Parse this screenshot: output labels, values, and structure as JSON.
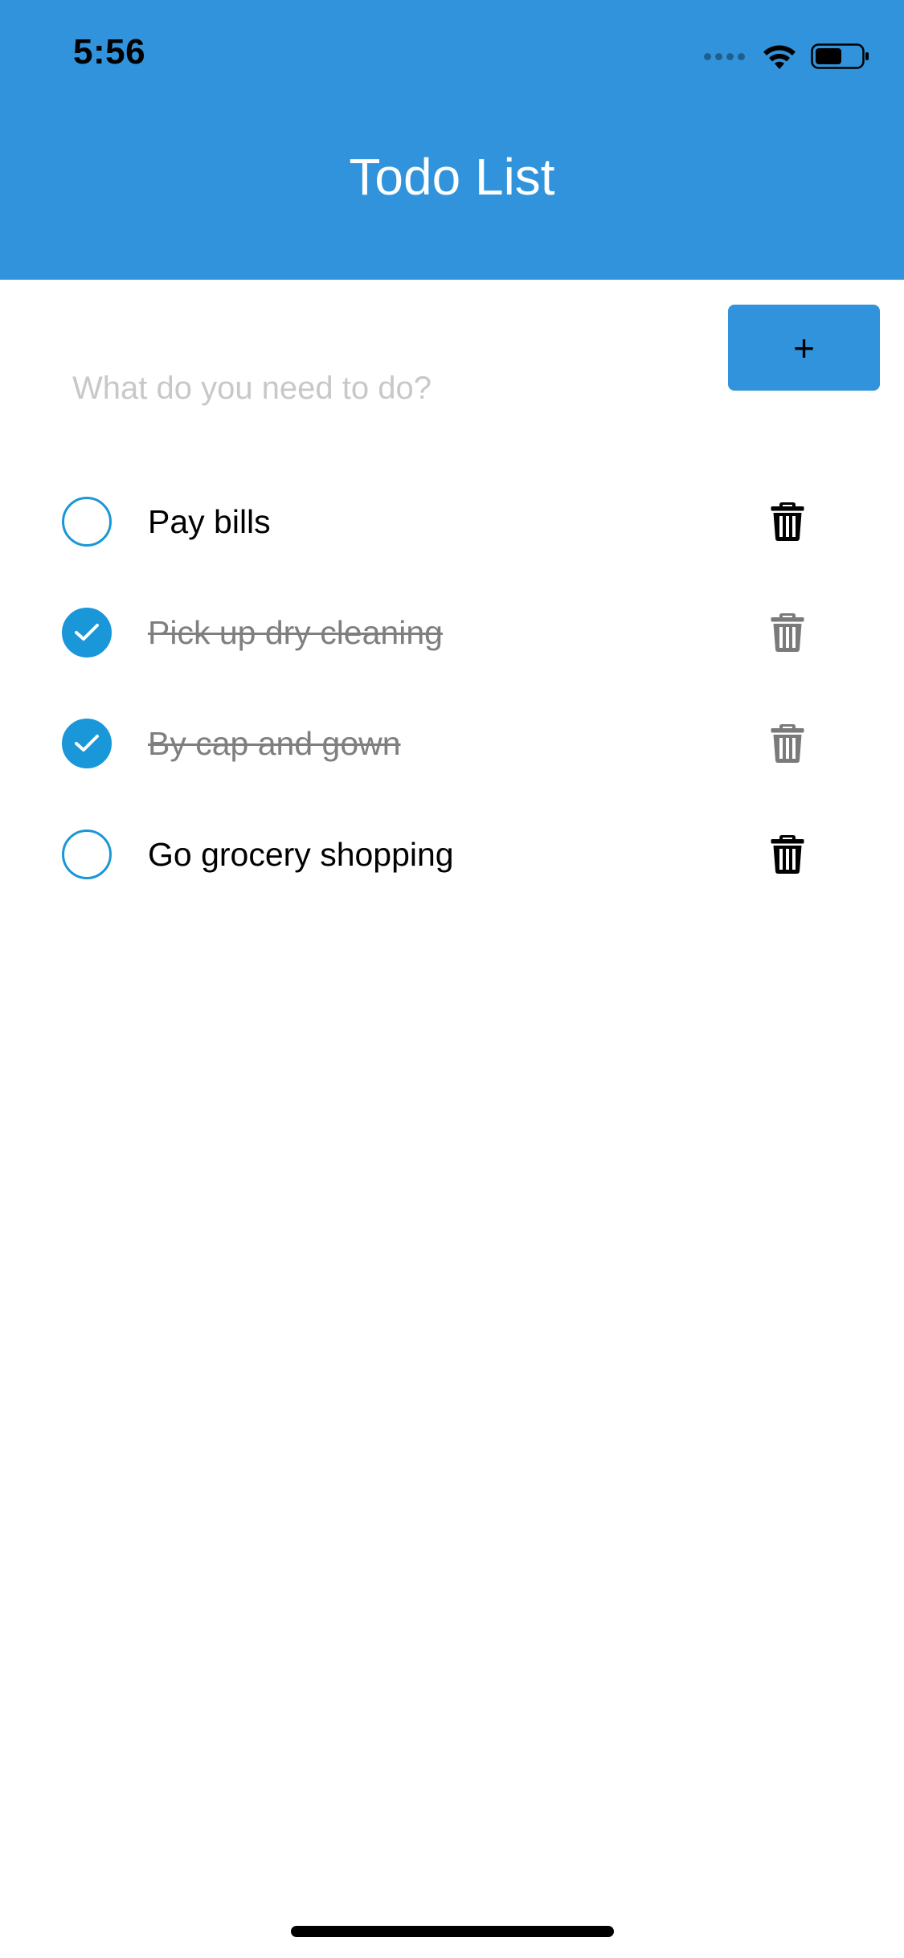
{
  "status_bar": {
    "time": "5:56",
    "icons": [
      "cellular-signal-icon",
      "wifi-icon",
      "battery-icon"
    ]
  },
  "header": {
    "title": "Todo List",
    "background_color": "#3193DB"
  },
  "new_todo": {
    "placeholder": "What do you need to do?",
    "value": "",
    "add_label": "+"
  },
  "todos": [
    {
      "text": "Pay bills",
      "completed": false
    },
    {
      "text": "Pick up dry cleaning",
      "completed": true
    },
    {
      "text": "By cap and gown",
      "completed": true
    },
    {
      "text": "Go grocery shopping",
      "completed": false
    }
  ],
  "colors": {
    "accent": "#3193DB",
    "checkbox": "#1A97D9",
    "completed_text": "#7F7F7F",
    "placeholder": "#C8C8C8"
  }
}
